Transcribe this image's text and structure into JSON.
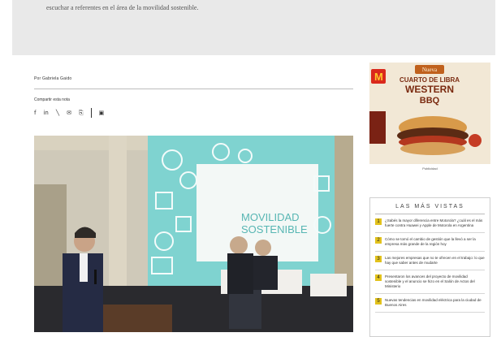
{
  "article": {
    "lead_text": "escuchar a referentes en el área de la movilidad sostenible.",
    "author": "Por Gabriela Gaido",
    "share_label": "Compartir esta nota",
    "share_icons": [
      "facebook-icon",
      "linkedin-icon",
      "x-icon",
      "email-icon",
      "copy-link-icon",
      "bookmark-icon"
    ]
  },
  "photo": {
    "screen_line1": "MOVILIDAD",
    "screen_line2": "SOSTENIBLE"
  },
  "ad": {
    "brand": "M",
    "tag": "Nueva",
    "headline1": "CUARTO DE LIBRA",
    "headline2": "WESTERN",
    "headline3": "BBQ",
    "caption": "Publicidad"
  },
  "most_viewed": {
    "title": "LAS MÁS VISTAS",
    "items": [
      {
        "num": "1",
        "text": "¿Sabés la mayor diferencia entre Motorola? ¿cuál es el más fuerte contra Huawei y Apple de Motorola en Argentina"
      },
      {
        "num": "2",
        "text": "Cómo se tomó el cambio de gestión que la llevó a ser la empresa más grande de la región hoy"
      },
      {
        "num": "3",
        "text": "Las mejores empresas que no te ofrecen en el trabajo: lo que hay que saber antes de mudarte"
      },
      {
        "num": "4",
        "text": "Presentaron los avances del proyecto de movilidad sostenible y el anuncio se hizo en el Salón de Actos del Ministerio"
      },
      {
        "num": "5",
        "text": "Nuevas tendencias en movilidad eléctrica para la ciudad de Buenos Aires"
      }
    ]
  },
  "colors": {
    "grey_band": "#e9e9e9",
    "accent_yellow": "#e2c21c",
    "screen_teal": "#7fd3d0"
  }
}
